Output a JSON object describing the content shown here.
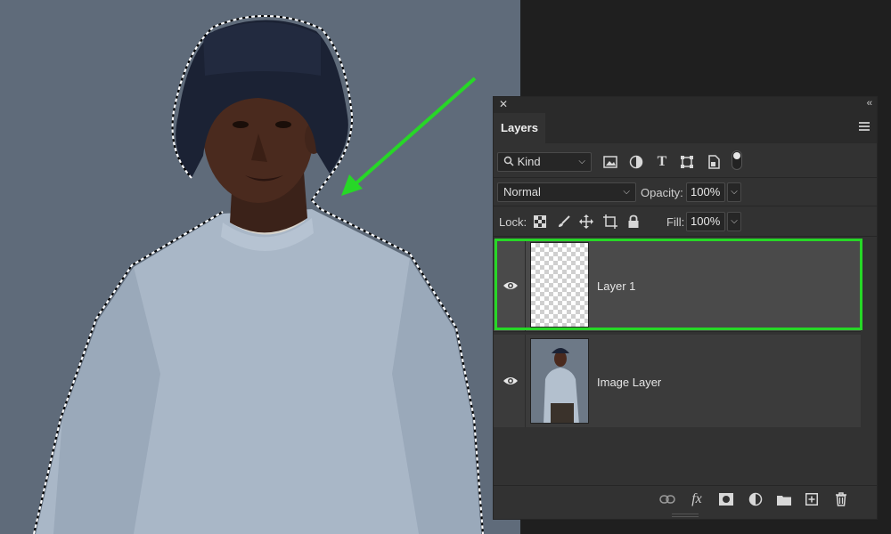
{
  "panel": {
    "close_glyph": "✕",
    "collapse_glyph": "‹‹",
    "tab_title": "Layers",
    "menu_icon": "panel-menu-icon"
  },
  "filter": {
    "kind_label": "Kind",
    "filter_icons": [
      "image-filter-icon",
      "adjustment-filter-icon",
      "type-filter-icon",
      "shape-filter-icon",
      "smart-object-filter-icon"
    ]
  },
  "blend": {
    "mode": "Normal",
    "opacity_label": "Opacity:",
    "opacity_value": "100%"
  },
  "lock": {
    "lock_label": "Lock:",
    "fill_label": "Fill:",
    "fill_value": "100%"
  },
  "layers": [
    {
      "name": "Layer 1",
      "visible": true,
      "selected": true,
      "thumbnail": "transparent"
    },
    {
      "name": "Image Layer",
      "visible": true,
      "selected": false,
      "thumbnail": "photo"
    }
  ],
  "footer_icons": [
    "link-layers-icon",
    "layer-style-fx-icon",
    "add-mask-icon",
    "adjustment-layer-icon",
    "new-group-icon",
    "new-layer-icon",
    "delete-layer-icon"
  ],
  "fx_text": "fx",
  "colors": {
    "highlight": "#27d727",
    "arrow": "#27d727",
    "canvas_bg": "#5f6b7a",
    "panel_bg": "#323232"
  }
}
